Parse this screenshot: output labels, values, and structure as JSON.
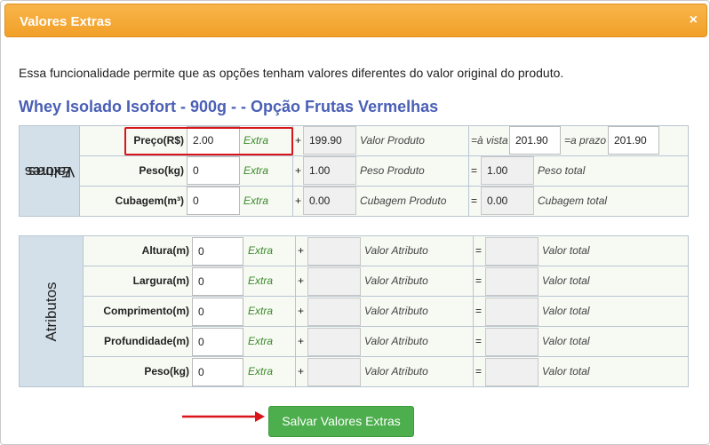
{
  "dialog": {
    "title": "Valores Extras",
    "close_label": "×",
    "intro": "Essa funcionalidade permite que as opções tenham valores diferentes do valor original do produto.",
    "product_title": "Whey Isolado Isofort - 900g - - Opção Frutas Vermelhas"
  },
  "extras": {
    "side_label_1": "Valores",
    "side_label_2": "Extras",
    "extra_label": "Extra",
    "plus": "+",
    "preco": {
      "label": "Preço(R$)",
      "value": "2.00",
      "base": "199.90",
      "base_note": "Valor Produto",
      "avista_label": "=à vista",
      "avista": "201.90",
      "aprazo_label": "=a prazo",
      "aprazo": "201.90"
    },
    "peso": {
      "label": "Peso(kg)",
      "value": "0",
      "base": "1.00",
      "base_note": "Peso Produto",
      "eq": "=",
      "total": "1.00",
      "total_note": "Peso total"
    },
    "cubagem": {
      "label": "Cubagem(m³)",
      "value": "0",
      "base": "0.00",
      "base_note": "Cubagem Produto",
      "eq": "=",
      "total": "0.00",
      "total_note": "Cubagem total"
    }
  },
  "atributos": {
    "side_label": "Atributos",
    "extra_label": "Extra",
    "plus": "+",
    "eq": "=",
    "attr_note": "Valor Atributo",
    "total_note": "Valor total",
    "rows": [
      {
        "label": "Altura(m)",
        "value": "0"
      },
      {
        "label": "Largura(m)",
        "value": "0"
      },
      {
        "label": "Comprimento(m)",
        "value": "0"
      },
      {
        "label": "Profundidade(m)",
        "value": "0"
      },
      {
        "label": "Peso(kg)",
        "value": "0"
      }
    ]
  },
  "save_label": "Salvar Valores Extras",
  "colors": {
    "header": "#f1a028",
    "product_title": "#4a5fb5",
    "extra_text": "#3a8a2a",
    "save_button": "#4cae4c",
    "highlight": "#d9141b"
  }
}
